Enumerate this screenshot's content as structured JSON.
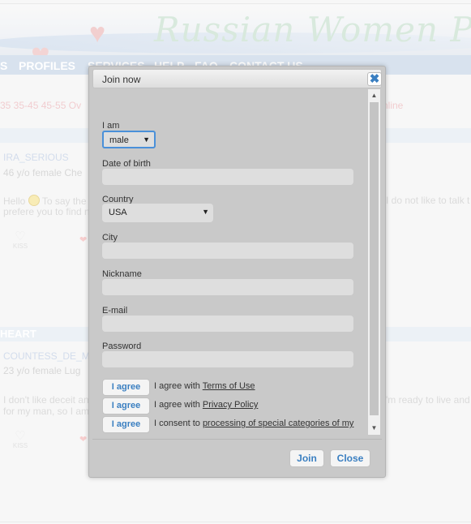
{
  "background": {
    "site_title": "Russian Women Personals",
    "nav": [
      {
        "label": "S"
      },
      {
        "label": "PROFILES"
      },
      {
        "label": "SERVICES"
      },
      {
        "label": "HELP"
      },
      {
        "label": "FAQ"
      },
      {
        "label": "CONTACT US"
      }
    ],
    "age_filters": "35  35-45  45-55  Ov",
    "online_label": "nline",
    "section_label": "HEART",
    "profiles": [
      {
        "name": "IRA_SERIOUS",
        "meta": "46 y/o female    Che",
        "text_line1": "Hello",
        "text_line1b": "To say the",
        "text_line2": "prefere you to find n",
        "text_right": "I do not like to talk t"
      },
      {
        "name": "COUNTESS_DE_M",
        "meta": "23 y/o female    Lug",
        "text_line1": "I don't like deceit an",
        "text_line2": "for my man, so I am",
        "text_right": "'m ready to live and"
      }
    ],
    "kiss_label": "KISS"
  },
  "modal": {
    "title": "Join now",
    "close_icon": "✖",
    "fields": {
      "i_am_label": "I am",
      "i_am_value": "male",
      "dob_label": "Date of birth",
      "dob_value": "",
      "country_label": "Country",
      "country_value": "USA",
      "city_label": "City",
      "city_value": "",
      "nickname_label": "Nickname",
      "nickname_value": "",
      "email_label": "E-mail",
      "email_value": "",
      "password_label": "Password",
      "password_value": ""
    },
    "agreements": [
      {
        "button": "I agree",
        "text": "I agree with ",
        "link": "Terms of Use "
      },
      {
        "button": "I agree",
        "text": "I agree with ",
        "link": "Privacy Policy"
      },
      {
        "button": "I agree",
        "text": "I consent to ",
        "link": "processing of special categories of my"
      }
    ],
    "footer": {
      "join_label": "Join",
      "close_label": "Close"
    }
  }
}
